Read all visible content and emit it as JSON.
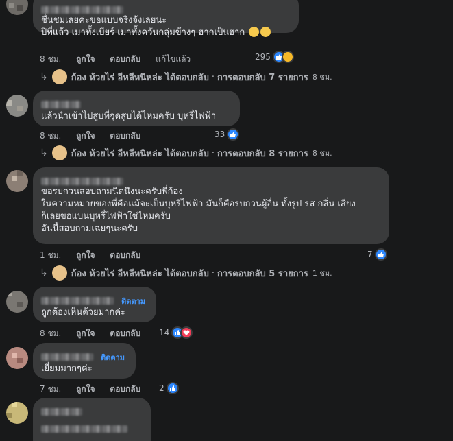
{
  "comments": [
    {
      "lines": [
        "ชื่นชมเลยค่ะขอแบบจริงจังเลยนะ",
        "ปีที่แล้ว เมาทั้งเบียร์ เมาทั้งควันกลุ่มข้างๆ ฮากเป็นฮาก"
      ],
      "time": "8 ชม.",
      "like": "ถูกใจ",
      "reply": "ตอบกลับ",
      "edited": "แก้ไขแล้ว",
      "reaction_count": "295",
      "reactions": [
        "like-icon",
        "haha-icon"
      ],
      "reply_summary": {
        "name": "ก้อง ห้วยไร่",
        "action": "อีหลีหนิหล่ะ ได้ตอบกลับ",
        "count_text": "การตอบกลับ 7 รายการ",
        "time": "8 ชม."
      }
    },
    {
      "lines": [
        "แล้วนำเข้าไปสูบที่จุดสูบได้ไหมครับ บุหรี่ไฟฟ้า"
      ],
      "time": "8 ชม.",
      "like": "ถูกใจ",
      "reply": "ตอบกลับ",
      "reaction_count": "33",
      "reactions": [
        "like-icon"
      ],
      "reply_summary": {
        "name": "ก้อง ห้วยไร่",
        "action": "อีหลีหนิหล่ะ ได้ตอบกลับ",
        "count_text": "การตอบกลับ 8 รายการ",
        "time": "8 ชม."
      }
    },
    {
      "lines": [
        "ขอรบกวนสอบถามนิดนึงนะครับพี่ก้อง",
        "ในความหมายของพี่คือแม้จะเป็นบุหรี่ไฟฟ้า มันก็คือรบกวนผู้อื่น ทั้งรูป รส กลิ่น เสียง",
        "ก็เลยขอแบนบุหรี่ไฟฟ้าใช่ไหมครับ",
        "อันนี้สอบถามเฉยๆนะครับ"
      ],
      "time": "1 ชม.",
      "like": "ถูกใจ",
      "reply": "ตอบกลับ",
      "reaction_count": "7",
      "reactions": [
        "like-icon"
      ],
      "reply_summary": {
        "name": "ก้อง ห้วยไร่",
        "action": "อีหลีหนิหล่ะ ได้ตอบกลับ",
        "count_text": "การตอบกลับ 5 รายการ",
        "time": "1 ชม."
      }
    },
    {
      "follow": "ติดตาม",
      "lines": [
        "ถูกต้องเห็นด้วยมากค่ะ"
      ],
      "time": "8 ชม.",
      "like": "ถูกใจ",
      "reply": "ตอบกลับ",
      "reaction_count": "14",
      "reactions": [
        "like-icon",
        "love-icon"
      ]
    },
    {
      "follow": "ติดตาม",
      "lines": [
        "เยี่ยมมากๆค่ะ"
      ],
      "time": "7 ชม.",
      "like": "ถูกใจ",
      "reply": "ตอบกลับ",
      "reaction_count": "2",
      "reactions": [
        "like-icon"
      ]
    }
  ],
  "colors": {
    "background": "#18191a",
    "bubble": "#3a3b3c",
    "text": "#e4e6eb",
    "muted": "#b0b3b8",
    "link": "#4599ff",
    "like": "#2d88ff",
    "love": "#f33e58",
    "haha": "#f7b928"
  }
}
